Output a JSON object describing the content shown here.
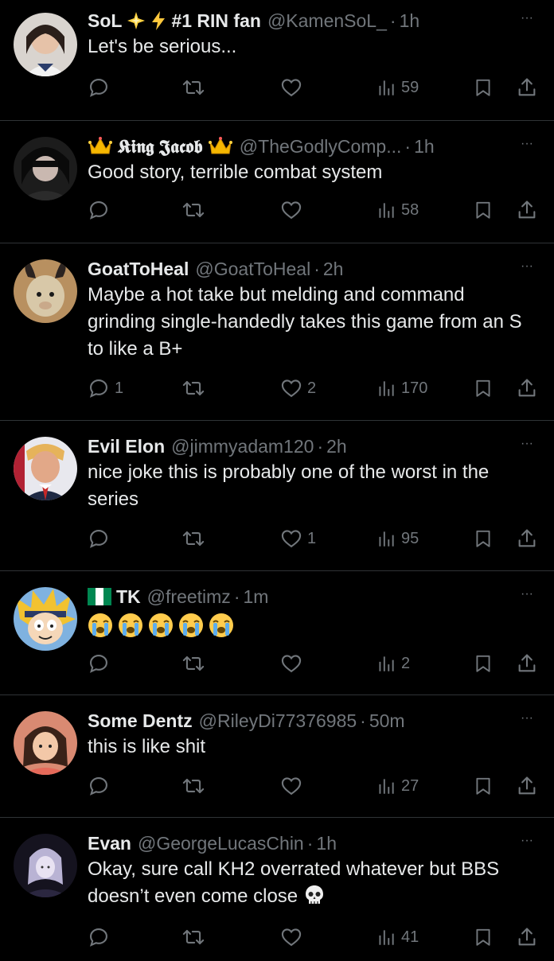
{
  "posts": [
    {
      "name": "SoL",
      "name_suffix": "#1 RIN fan",
      "handle": "@KamenSoL_",
      "time": "1h",
      "text": "Let's be serious...",
      "replies": "",
      "retweets": "",
      "likes": "",
      "views": "59"
    },
    {
      "name": "𝕶𝖎𝖓𝖌 𝕵𝖆𝖈𝖔𝖇",
      "handle": "@TheGodlyComp...",
      "time": "1h",
      "text": "Good story, terrible combat system",
      "replies": "",
      "retweets": "",
      "likes": "",
      "views": "58"
    },
    {
      "name": "GoatToHeal",
      "handle": "@GoatToHeal",
      "time": "2h",
      "text": "Maybe a hot take but melding and command grinding single-handedly takes this game from an S to like a B+",
      "replies": "1",
      "retweets": "",
      "likes": "2",
      "views": "170"
    },
    {
      "name": "Evil Elon",
      "handle": "@jimmyadam120",
      "time": "2h",
      "text": "nice joke this is probably one of the worst in the series",
      "replies": "",
      "retweets": "",
      "likes": "1",
      "views": "95"
    },
    {
      "name": "TK",
      "handle": "@freetimz",
      "time": "1m",
      "text": "",
      "replies": "",
      "retweets": "",
      "likes": "",
      "views": "2"
    },
    {
      "name": "Some Dentz",
      "handle": "@RileyDi77376985",
      "time": "50m",
      "text": "this is like shit",
      "replies": "",
      "retweets": "",
      "likes": "",
      "views": "27"
    },
    {
      "name": "Evan",
      "handle": "@GeorgeLucasChin",
      "time": "1h",
      "text": "Okay, sure call KH2 overrated whatever but BBS doesn’t even come close",
      "replies": "",
      "retweets": "",
      "likes": "",
      "views": "41"
    }
  ],
  "ui": {
    "dot": "·",
    "more": "···"
  },
  "colors": {
    "background": "#000000",
    "text": "#e7e9ea",
    "muted": "#71767b",
    "divider": "#2f3336"
  }
}
